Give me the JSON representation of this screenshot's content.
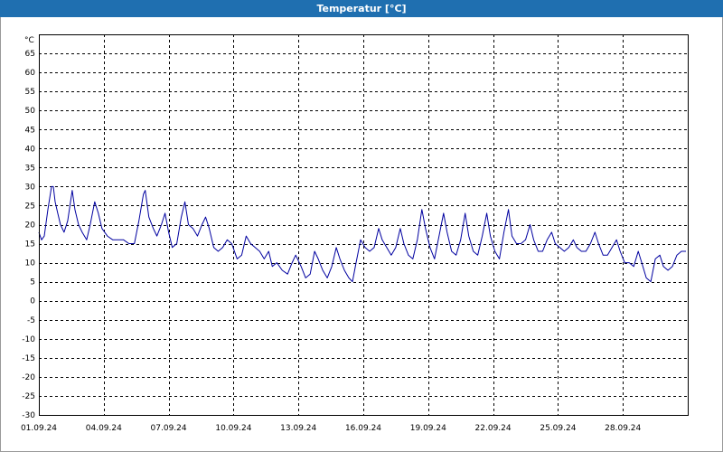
{
  "window": {
    "title": "Temperatur [°C]"
  },
  "colors": {
    "titlebar": "#1f6fb0",
    "line": "#0000a0",
    "grid": "#000000"
  },
  "chart_data": {
    "type": "line",
    "title": "Temperatur [°C]",
    "ylabel": "°C",
    "xlabel": "",
    "ylim": [
      -30,
      70
    ],
    "xlim": [
      "2024-09-01",
      "2024-10-01"
    ],
    "yticks": [
      65,
      60,
      55,
      50,
      45,
      40,
      35,
      30,
      25,
      20,
      15,
      10,
      5,
      0,
      -5,
      -10,
      -15,
      -20,
      -25,
      -30
    ],
    "xticks": [
      {
        "date": "2024-09-01",
        "label": "01.09.24"
      },
      {
        "date": "2024-09-04",
        "label": "04.09.24"
      },
      {
        "date": "2024-09-07",
        "label": "07.09.24"
      },
      {
        "date": "2024-09-10",
        "label": "10.09.24"
      },
      {
        "date": "2024-09-13",
        "label": "13.09.24"
      },
      {
        "date": "2024-09-16",
        "label": "16.09.24"
      },
      {
        "date": "2024-09-19",
        "label": "19.09.24"
      },
      {
        "date": "2024-09-22",
        "label": "22.09.24"
      },
      {
        "date": "2024-09-25",
        "label": "25.09.24"
      },
      {
        "date": "2024-09-28",
        "label": "28.09.24"
      }
    ],
    "grid": true,
    "series": [
      {
        "name": "",
        "points": [
          [
            "2024-09-01 00:00",
            18
          ],
          [
            "2024-09-01 03:00",
            16
          ],
          [
            "2024-09-01 06:00",
            17
          ],
          [
            "2024-09-01 10:00",
            24
          ],
          [
            "2024-09-01 14:00",
            30
          ],
          [
            "2024-09-01 16:00",
            30
          ],
          [
            "2024-09-01 18:00",
            26
          ],
          [
            "2024-09-01 21:00",
            23
          ],
          [
            "2024-09-02 00:00",
            20
          ],
          [
            "2024-09-02 04:00",
            18
          ],
          [
            "2024-09-02 08:00",
            21
          ],
          [
            "2024-09-02 13:00",
            29
          ],
          [
            "2024-09-02 16:00",
            24
          ],
          [
            "2024-09-02 20:00",
            20
          ],
          [
            "2024-09-03 00:00",
            18
          ],
          [
            "2024-09-03 05:00",
            16
          ],
          [
            "2024-09-03 09:00",
            20
          ],
          [
            "2024-09-03 14:00",
            26
          ],
          [
            "2024-09-03 18:00",
            23
          ],
          [
            "2024-09-03 22:00",
            19
          ],
          [
            "2024-09-04 04:00",
            17
          ],
          [
            "2024-09-04 10:00",
            16
          ],
          [
            "2024-09-04 16:00",
            16
          ],
          [
            "2024-09-04 22:00",
            16
          ],
          [
            "2024-09-05 04:00",
            15
          ],
          [
            "2024-09-05 10:00",
            15
          ],
          [
            "2024-09-05 15:00",
            21
          ],
          [
            "2024-09-05 20:00",
            28
          ],
          [
            "2024-09-05 22:00",
            29
          ],
          [
            "2024-09-06 02:00",
            22
          ],
          [
            "2024-09-06 07:00",
            19
          ],
          [
            "2024-09-06 11:00",
            17
          ],
          [
            "2024-09-06 16:00",
            20
          ],
          [
            "2024-09-06 20:00",
            23
          ],
          [
            "2024-09-07 00:00",
            18
          ],
          [
            "2024-09-07 04:00",
            14
          ],
          [
            "2024-09-07 09:00",
            15
          ],
          [
            "2024-09-07 14:00",
            22
          ],
          [
            "2024-09-07 18:00",
            26
          ],
          [
            "2024-09-07 22:00",
            20
          ],
          [
            "2024-09-08 03:00",
            19
          ],
          [
            "2024-09-08 08:00",
            17
          ],
          [
            "2024-09-08 13:00",
            20
          ],
          [
            "2024-09-08 17:00",
            22
          ],
          [
            "2024-09-08 21:00",
            19
          ],
          [
            "2024-09-09 02:00",
            14
          ],
          [
            "2024-09-09 07:00",
            13
          ],
          [
            "2024-09-09 12:00",
            14
          ],
          [
            "2024-09-09 17:00",
            16
          ],
          [
            "2024-09-09 22:00",
            15
          ],
          [
            "2024-09-10 04:00",
            11
          ],
          [
            "2024-09-10 09:00",
            12
          ],
          [
            "2024-09-10 14:00",
            17
          ],
          [
            "2024-09-10 19:00",
            15
          ],
          [
            "2024-09-11 00:00",
            14
          ],
          [
            "2024-09-11 05:00",
            13
          ],
          [
            "2024-09-11 10:00",
            11
          ],
          [
            "2024-09-11 15:00",
            13
          ],
          [
            "2024-09-11 19:00",
            9
          ],
          [
            "2024-09-12 00:00",
            10
          ],
          [
            "2024-09-12 06:00",
            8
          ],
          [
            "2024-09-12 12:00",
            7
          ],
          [
            "2024-09-12 17:00",
            10
          ],
          [
            "2024-09-12 21:00",
            12
          ],
          [
            "2024-09-13 03:00",
            9
          ],
          [
            "2024-09-13 08:00",
            6
          ],
          [
            "2024-09-13 13:00",
            7
          ],
          [
            "2024-09-13 18:00",
            13
          ],
          [
            "2024-09-13 22:00",
            11
          ],
          [
            "2024-09-14 03:00",
            8
          ],
          [
            "2024-09-14 08:00",
            6
          ],
          [
            "2024-09-14 13:00",
            9
          ],
          [
            "2024-09-14 18:00",
            14
          ],
          [
            "2024-09-14 22:00",
            11
          ],
          [
            "2024-09-15 03:00",
            8
          ],
          [
            "2024-09-15 08:00",
            6
          ],
          [
            "2024-09-15 12:00",
            5
          ],
          [
            "2024-09-15 16:00",
            10
          ],
          [
            "2024-09-15 21:00",
            16
          ],
          [
            "2024-09-16 02:00",
            14
          ],
          [
            "2024-09-16 07:00",
            13
          ],
          [
            "2024-09-16 12:00",
            14
          ],
          [
            "2024-09-16 17:00",
            19
          ],
          [
            "2024-09-16 21:00",
            16
          ],
          [
            "2024-09-17 02:00",
            14
          ],
          [
            "2024-09-17 07:00",
            12
          ],
          [
            "2024-09-17 12:00",
            14
          ],
          [
            "2024-09-17 17:00",
            19
          ],
          [
            "2024-09-17 21:00",
            15
          ],
          [
            "2024-09-18 02:00",
            12
          ],
          [
            "2024-09-18 07:00",
            11
          ],
          [
            "2024-09-18 12:00",
            16
          ],
          [
            "2024-09-18 17:00",
            24
          ],
          [
            "2024-09-18 21:00",
            19
          ],
          [
            "2024-09-19 02:00",
            14
          ],
          [
            "2024-09-19 07:00",
            11
          ],
          [
            "2024-09-19 12:00",
            17
          ],
          [
            "2024-09-19 17:00",
            23
          ],
          [
            "2024-09-19 21:00",
            18
          ],
          [
            "2024-09-20 02:00",
            13
          ],
          [
            "2024-09-20 07:00",
            12
          ],
          [
            "2024-09-20 12:00",
            16
          ],
          [
            "2024-09-20 17:00",
            23
          ],
          [
            "2024-09-20 21:00",
            17
          ],
          [
            "2024-09-21 02:00",
            13
          ],
          [
            "2024-09-21 07:00",
            12
          ],
          [
            "2024-09-21 12:00",
            17
          ],
          [
            "2024-09-21 17:00",
            23
          ],
          [
            "2024-09-21 21:00",
            17
          ],
          [
            "2024-09-22 02:00",
            13
          ],
          [
            "2024-09-22 07:00",
            11
          ],
          [
            "2024-09-22 12:00",
            18
          ],
          [
            "2024-09-22 17:00",
            24
          ],
          [
            "2024-09-22 21:00",
            17
          ],
          [
            "2024-09-23 02:00",
            15
          ],
          [
            "2024-09-23 07:00",
            15
          ],
          [
            "2024-09-23 12:00",
            16
          ],
          [
            "2024-09-23 17:00",
            20
          ],
          [
            "2024-09-23 21:00",
            16
          ],
          [
            "2024-09-24 02:00",
            13
          ],
          [
            "2024-09-24 07:00",
            13
          ],
          [
            "2024-09-24 12:00",
            16
          ],
          [
            "2024-09-24 17:00",
            18
          ],
          [
            "2024-09-24 21:00",
            15
          ],
          [
            "2024-09-25 02:00",
            14
          ],
          [
            "2024-09-25 07:00",
            13
          ],
          [
            "2024-09-25 12:00",
            14
          ],
          [
            "2024-09-25 17:00",
            16
          ],
          [
            "2024-09-25 21:00",
            14
          ],
          [
            "2024-09-26 02:00",
            13
          ],
          [
            "2024-09-26 07:00",
            13
          ],
          [
            "2024-09-26 12:00",
            15
          ],
          [
            "2024-09-26 17:00",
            18
          ],
          [
            "2024-09-26 21:00",
            15
          ],
          [
            "2024-09-27 02:00",
            12
          ],
          [
            "2024-09-27 07:00",
            12
          ],
          [
            "2024-09-27 12:00",
            14
          ],
          [
            "2024-09-27 17:00",
            16
          ],
          [
            "2024-09-27 21:00",
            13
          ],
          [
            "2024-09-28 02:00",
            10
          ],
          [
            "2024-09-28 07:00",
            10
          ],
          [
            "2024-09-28 12:00",
            9
          ],
          [
            "2024-09-28 17:00",
            13
          ],
          [
            "2024-09-28 21:00",
            10
          ],
          [
            "2024-09-29 02:00",
            6
          ],
          [
            "2024-09-29 07:00",
            5
          ],
          [
            "2024-09-29 12:00",
            11
          ],
          [
            "2024-09-29 17:00",
            12
          ],
          [
            "2024-09-29 21:00",
            9
          ],
          [
            "2024-09-30 02:00",
            8
          ],
          [
            "2024-09-30 07:00",
            9
          ],
          [
            "2024-09-30 12:00",
            12
          ],
          [
            "2024-09-30 17:00",
            13
          ],
          [
            "2024-09-30 22:00",
            13
          ]
        ]
      }
    ]
  }
}
